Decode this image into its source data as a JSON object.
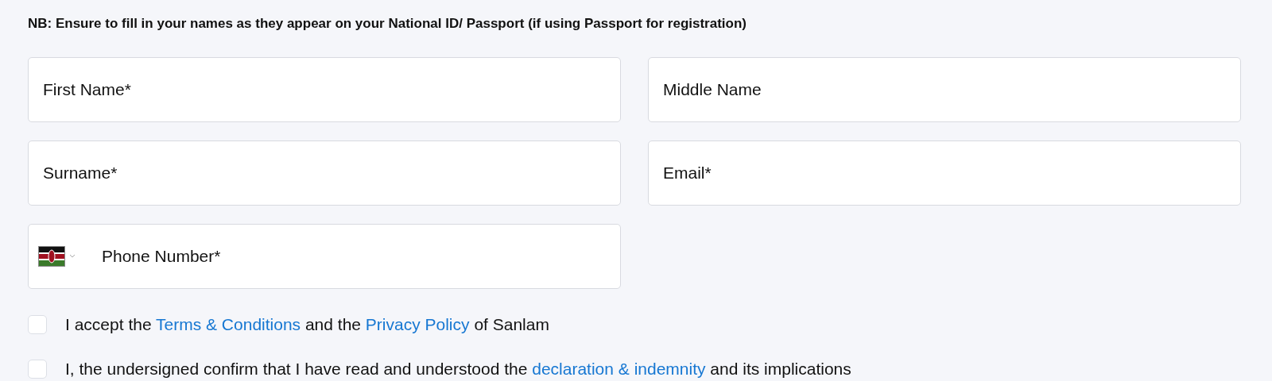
{
  "note": "NB: Ensure to fill in your names as they appear on your National ID/ Passport (if using Passport for registration)",
  "fields": [
    {
      "placeholder": "First Name*",
      "kind": "text"
    },
    {
      "placeholder": "Middle Name",
      "kind": "text"
    },
    {
      "placeholder": "Surname*",
      "kind": "text"
    },
    {
      "placeholder": "Email*",
      "kind": "text"
    },
    {
      "placeholder": "Phone Number*",
      "kind": "phone"
    }
  ],
  "agreements": [
    {
      "checked": false,
      "parts": [
        {
          "kind": "text",
          "text": "I accept the "
        },
        {
          "kind": "link",
          "text": "Terms & Conditions"
        },
        {
          "kind": "text",
          "text": " and the "
        },
        {
          "kind": "link",
          "text": "Privacy Policy"
        },
        {
          "kind": "text",
          "text": " of Sanlam"
        }
      ]
    },
    {
      "checked": false,
      "parts": [
        {
          "kind": "text",
          "text": "I, the undersigned confirm that I have read and understood the "
        },
        {
          "kind": "link",
          "text": "declaration & indemnity"
        },
        {
          "kind": "text",
          "text": " and its implications"
        }
      ]
    }
  ]
}
